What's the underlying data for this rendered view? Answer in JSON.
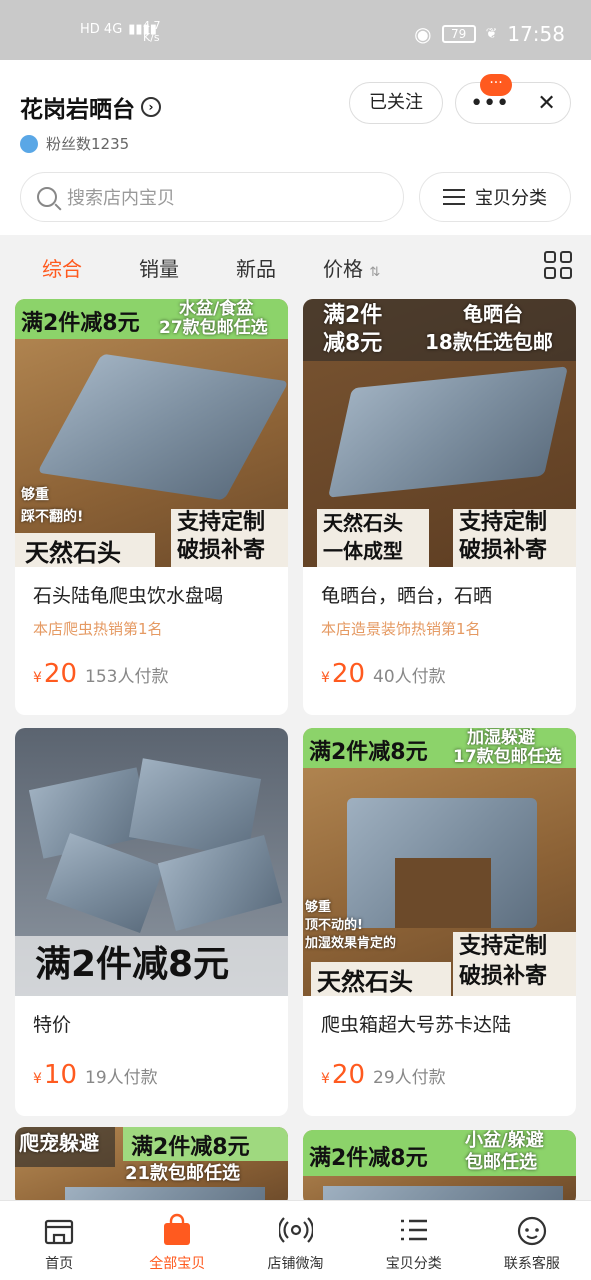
{
  "status": {
    "network": "HD 4G",
    "speed_value": "4.7",
    "speed_unit": "K/s",
    "battery": "79",
    "time": "17:58"
  },
  "shop": {
    "name": "花岗岩晒台",
    "fans": "粉丝数1235",
    "follow_label": "已关注",
    "badge": "···"
  },
  "search": {
    "placeholder": "搜索店内宝贝",
    "category_label": "宝贝分类"
  },
  "sort": {
    "items": [
      "综合",
      "销量",
      "新品",
      "价格"
    ]
  },
  "products": [
    {
      "img_tag_big": "满2件减8元",
      "img_tag_right1": "水盆/食盆",
      "img_tag_right2": "27款包邮任选",
      "img_hand1": "够重",
      "img_hand2": "踩不翻的!",
      "img_banner_left": "天然石头",
      "img_banner_r1": "支持定制",
      "img_banner_r2": "破损补寄",
      "title": "石头陆龟爬虫饮水盘喝",
      "subtitle": "本店爬虫热销第1名",
      "price": "20",
      "paid": "153人付款"
    },
    {
      "img_tag_big1": "满2件",
      "img_tag_big2": "减8元",
      "img_tag_right1": "龟晒台",
      "img_tag_right2": "18款任选包邮",
      "img_banner_l1": "天然石头",
      "img_banner_l2": "一体成型",
      "img_banner_r1": "支持定制",
      "img_banner_r2": "破损补寄",
      "title": "龟晒台，晒台，石晒",
      "subtitle": "本店造景装饰热销第1名",
      "price": "20",
      "paid": "40人付款"
    },
    {
      "img_banner": "满2件减8元",
      "title": "特价",
      "price": "10",
      "paid": "19人付款"
    },
    {
      "img_tag_big": "满2件减8元",
      "img_tag_right1": "加湿躲避",
      "img_tag_right2": "17款包邮任选",
      "img_hand1": "够重",
      "img_hand2": "顶不动的!",
      "img_hand3": "加湿效果肯定的",
      "img_banner_left": "天然石头",
      "img_banner_r1": "支持定制",
      "img_banner_r2": "破损补寄",
      "title": "爬虫箱超大号苏卡达陆",
      "price": "20",
      "paid": "29人付款"
    },
    {
      "img_tag_left": "爬宠躲避",
      "img_tag_big": "满2件减8元",
      "img_tag_right2": "21款包邮任选"
    },
    {
      "img_tag_big": "满2件减8元",
      "img_tag_right1": "小盆/躲避",
      "img_tag_right2": "包邮任选"
    }
  ],
  "currency": "¥",
  "tabs": [
    "首页",
    "全部宝贝",
    "店铺微淘",
    "宝贝分类",
    "联系客服"
  ]
}
